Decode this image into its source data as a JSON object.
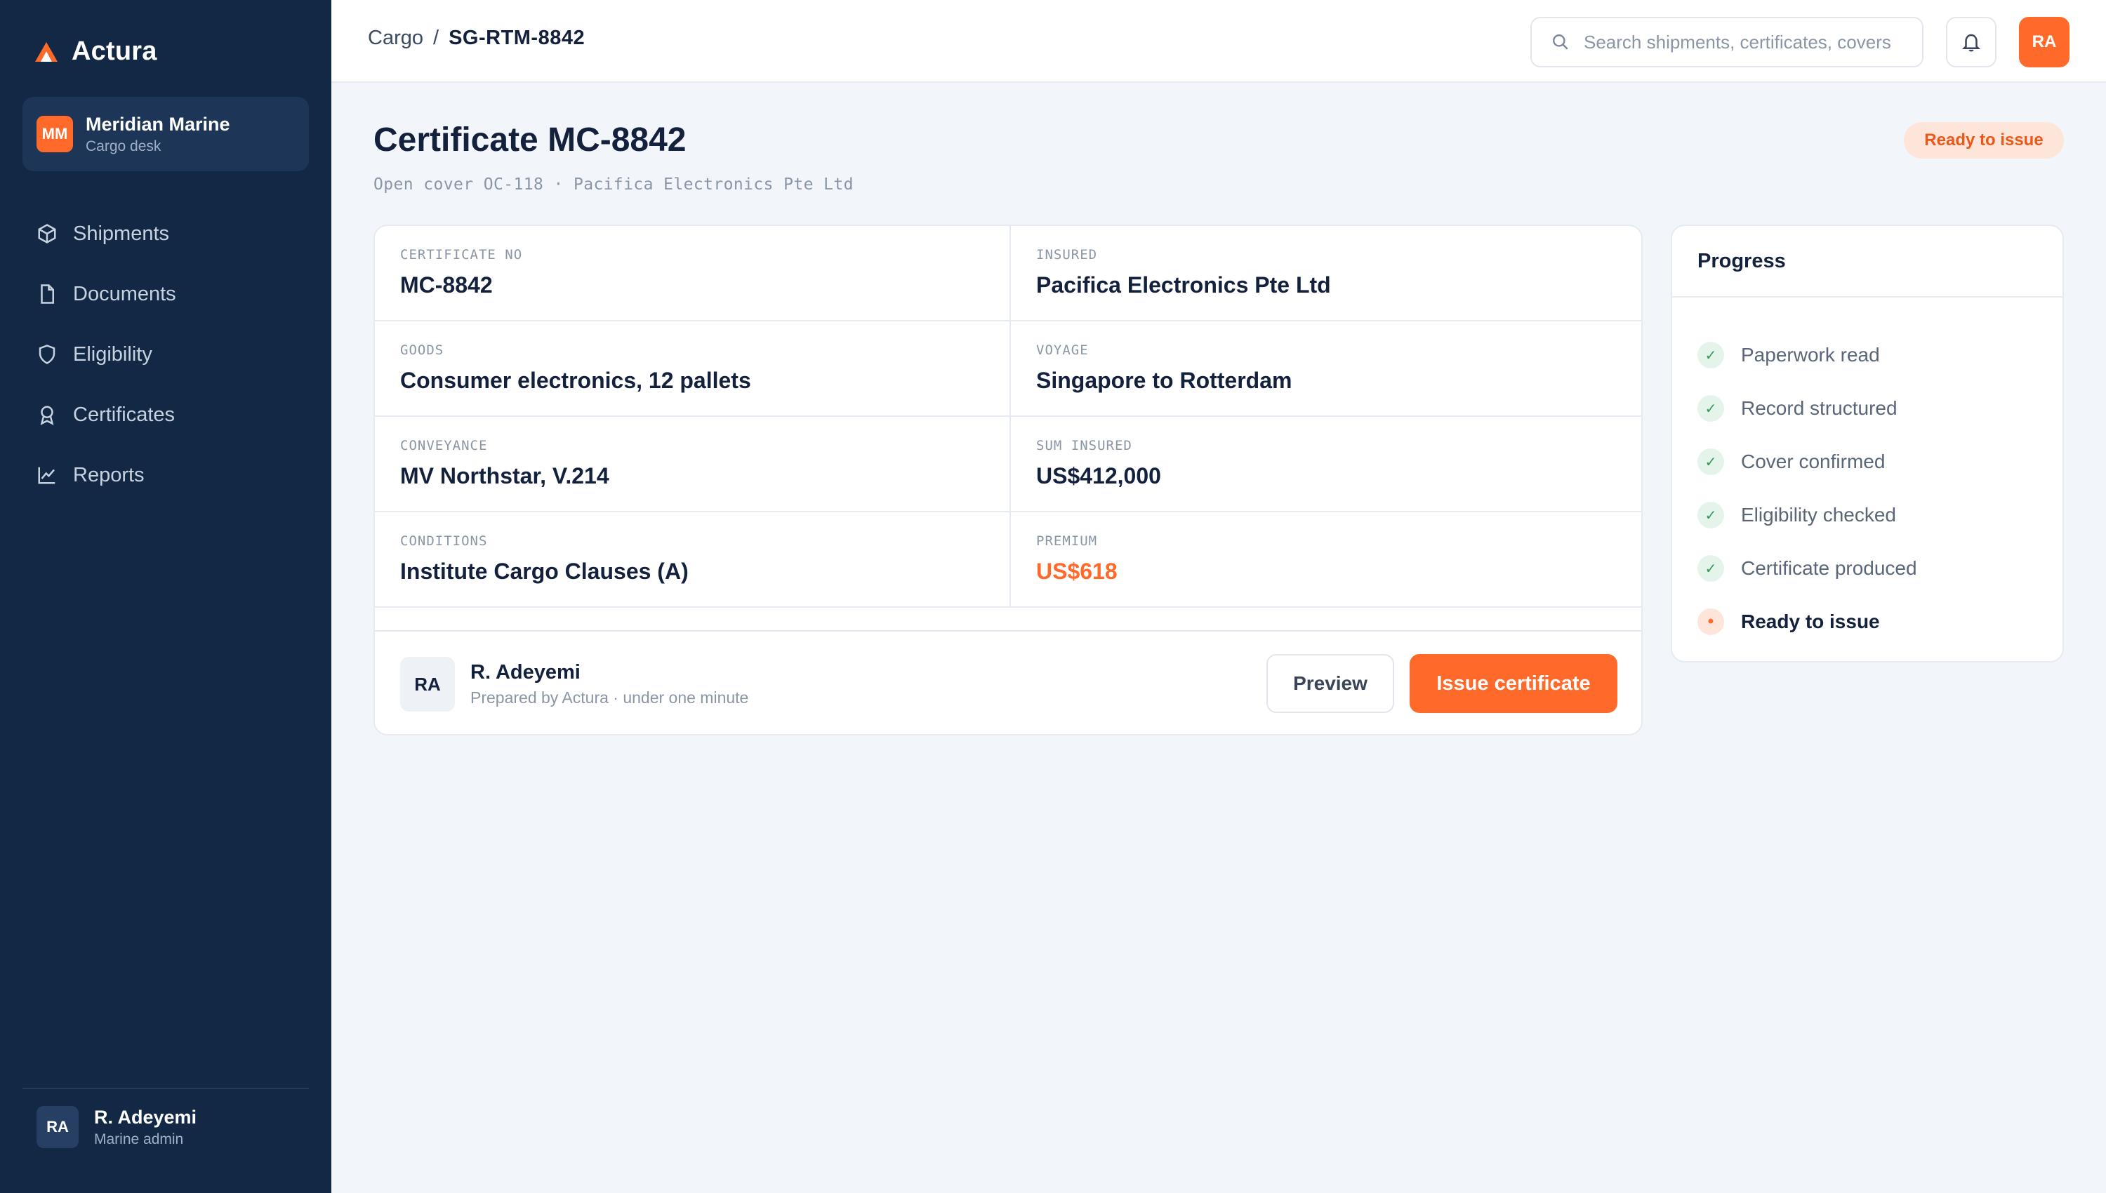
{
  "brand": {
    "name": "Actura"
  },
  "org": {
    "initials": "MM",
    "name": "Meridian Marine",
    "sub": "Cargo desk"
  },
  "nav": [
    {
      "label": "Shipments",
      "icon": "box-icon"
    },
    {
      "label": "Documents",
      "icon": "document-icon"
    },
    {
      "label": "Eligibility",
      "icon": "shield-icon"
    },
    {
      "label": "Certificates",
      "icon": "award-icon"
    },
    {
      "label": "Reports",
      "icon": "chart-icon"
    }
  ],
  "user": {
    "initials": "RA",
    "name": "R. Adeyemi",
    "role": "Marine admin"
  },
  "topbar": {
    "breadcrumb_root": "Cargo",
    "breadcrumb_sep": "/",
    "breadcrumb_current": "SG-RTM-8842",
    "search_placeholder": "Search shipments, certificates, covers",
    "avatar_initials": "RA"
  },
  "header": {
    "title": "Certificate MC-8842",
    "subtitle": "Open cover OC-118 · Pacifica Electronics Pte Ltd",
    "status": "Ready to issue"
  },
  "details": {
    "certificate_no": {
      "label": "CERTIFICATE NO",
      "value": "MC-8842"
    },
    "insured": {
      "label": "INSURED",
      "value": "Pacifica Electronics Pte Ltd"
    },
    "goods": {
      "label": "GOODS",
      "value": "Consumer electronics, 12 pallets"
    },
    "voyage": {
      "label": "VOYAGE",
      "value": "Singapore to Rotterdam"
    },
    "conveyance": {
      "label": "CONVEYANCE",
      "value": "MV Northstar, V.214"
    },
    "sum_insured": {
      "label": "SUM INSURED",
      "value": "US$412,000"
    },
    "conditions": {
      "label": "CONDITIONS",
      "value": "Institute Cargo Clauses (A)"
    },
    "premium": {
      "label": "PREMIUM",
      "value": "US$618"
    }
  },
  "preparer": {
    "initials": "RA",
    "name": "R. Adeyemi",
    "note": "Prepared by Actura · under one minute"
  },
  "actions": {
    "preview": "Preview",
    "issue": "Issue certificate"
  },
  "progress": {
    "title": "Progress",
    "done_mark": "✓",
    "current_mark": "•",
    "steps": [
      "Paperwork read",
      "Record structured",
      "Cover confirmed",
      "Eligibility checked",
      "Certificate produced",
      "Ready to issue"
    ]
  },
  "colors": {
    "sidebar": "#132845",
    "accent": "#ff6a2b",
    "success": "#2f9a5b"
  }
}
